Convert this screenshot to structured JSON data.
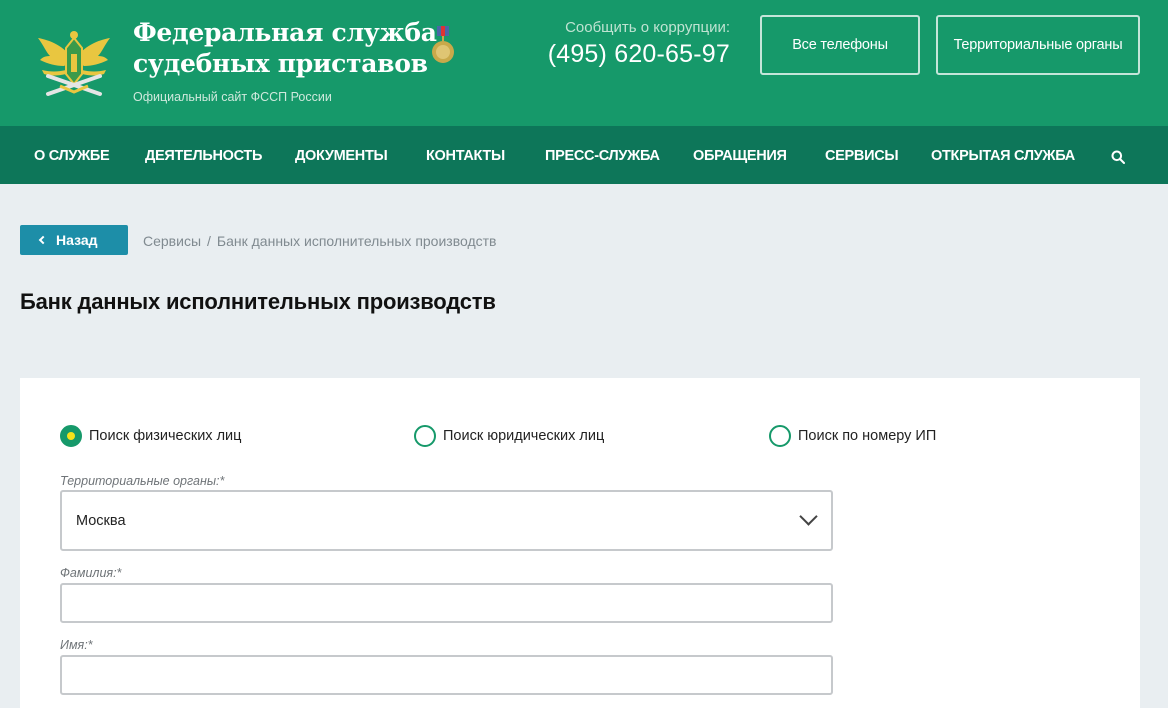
{
  "header": {
    "title_line1": "Федеральная служба",
    "title_line2": "судебных приставов",
    "subtitle": "Официальный сайт ФССП России",
    "corruption_label": "Сообщить о коррупции:",
    "corruption_phone": "(495) 620-65-97",
    "all_phones_label": "Все телефоны",
    "territorial_label": "Территориальные органы"
  },
  "nav": {
    "items": [
      "О СЛУЖБЕ",
      "ДЕЯТЕЛЬНОСТЬ",
      "ДОКУМЕНТЫ",
      "КОНТАКТЫ",
      "ПРЕСС-СЛУЖБА",
      "ОБРАЩЕНИЯ",
      "СЕРВИСЫ",
      "ОТКРЫТАЯ СЛУЖБА"
    ],
    "search_icon": "search-icon"
  },
  "back_label": "Назад",
  "breadcrumb": {
    "items": [
      "Сервисы",
      "Банк данных исполнительных производств"
    ],
    "separator": "/"
  },
  "page_title": "Банк данных исполнительных производств",
  "form": {
    "radios": [
      {
        "label": "Поиск физических лиц",
        "checked": true
      },
      {
        "label": "Поиск юридических лиц",
        "checked": false
      },
      {
        "label": "Поиск по номеру ИП",
        "checked": false
      }
    ],
    "territorial_label": "Территориальные органы:*",
    "territorial_value": "Москва",
    "surname_label": "Фамилия:*",
    "surname_value": "",
    "name_label": "Имя:*",
    "name_value": ""
  },
  "colors": {
    "header_green": "#16996a",
    "nav_green": "#0d7659",
    "back_blue": "#1d8ea8",
    "radio_dot": "#f5e31b"
  }
}
